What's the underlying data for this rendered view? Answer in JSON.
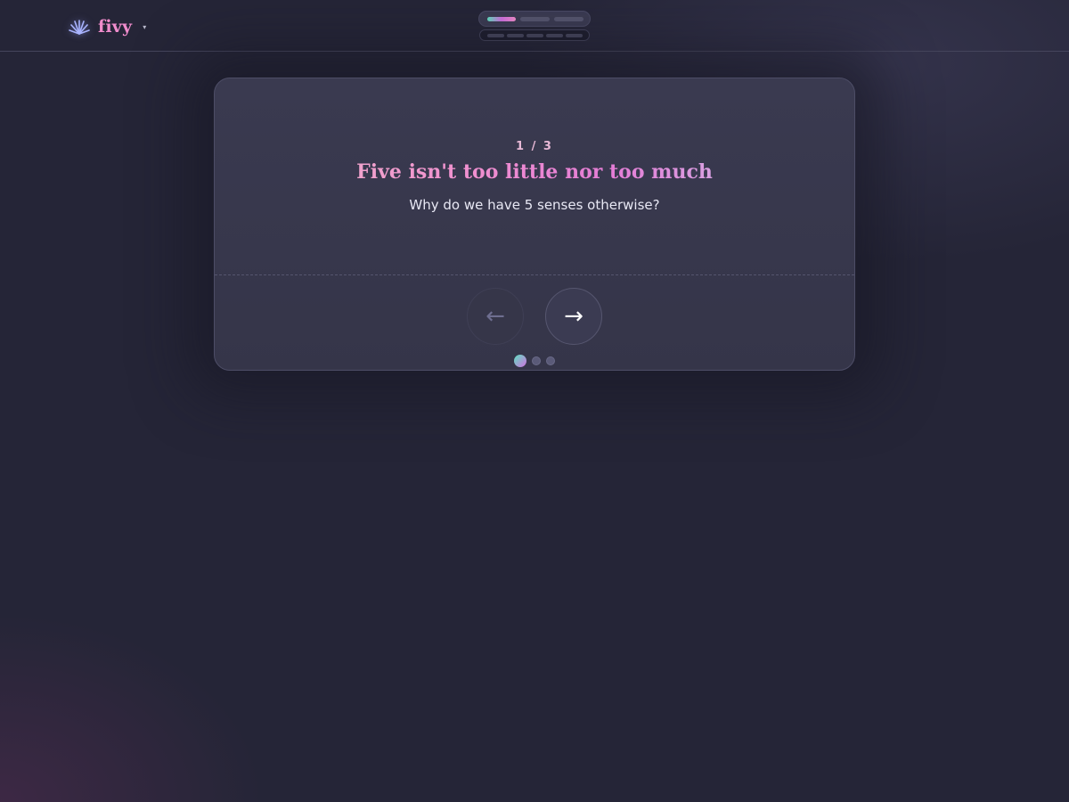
{
  "header": {
    "brand_name": "fivy",
    "brand_icon": "plant-icon",
    "caret_icon": "caret-down-icon",
    "caret_glyph": "▾",
    "progress": {
      "segments_total": 3,
      "segments_active": 1,
      "sub_segments_total": 5
    }
  },
  "card": {
    "counter": "1 / 3",
    "headline": "Five isn't too little nor too much",
    "subline": "Why do we have 5 senses otherwise?",
    "prev_glyph": "←",
    "next_glyph": "→",
    "prev_disabled": true,
    "dots_total": 3,
    "dots_active_index": 0
  },
  "colors": {
    "background": "#252537",
    "accent_pink": "#f08ccc",
    "accent_teal": "#5fe0c0",
    "accent_violet": "#d070e0"
  }
}
